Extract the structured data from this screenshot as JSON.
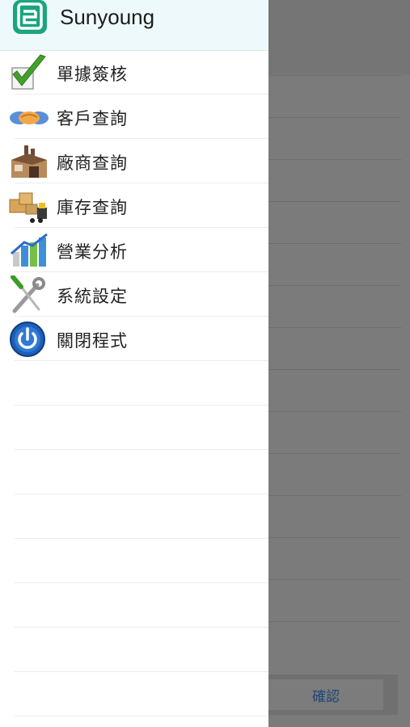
{
  "app": {
    "title": "Sunyoung"
  },
  "menu": [
    {
      "label": "單據簽核",
      "icon": "check-icon"
    },
    {
      "label": "客戶查詢",
      "icon": "handshake-icon"
    },
    {
      "label": "廠商查詢",
      "icon": "factory-icon"
    },
    {
      "label": "庫存查詢",
      "icon": "warehouse-forklift-icon"
    },
    {
      "label": "營業分析",
      "icon": "bar-chart-icon"
    },
    {
      "label": "系統設定",
      "icon": "tools-icon"
    },
    {
      "label": "關閉程式",
      "icon": "power-icon"
    }
  ],
  "background": {
    "confirm_label": "確認"
  },
  "colors": {
    "drawer_header_bg": "#eef9fb",
    "overlay": "#7b7b7b",
    "logo": "#1aa57f"
  }
}
